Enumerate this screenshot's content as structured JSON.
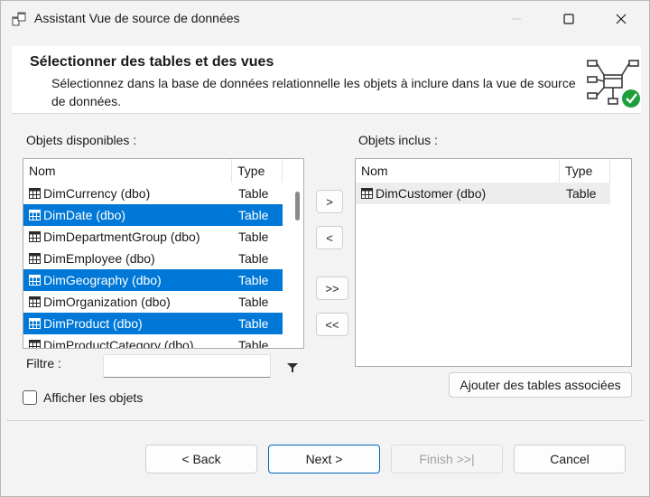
{
  "window": {
    "title": "Assistant Vue de source de données",
    "icon": "data-source-view-icon"
  },
  "header": {
    "title": "Sélectionner des tables et des vues",
    "description": "Sélectionnez dans la base de données relationnelle les objets à inclure dans la vue de source de données.",
    "icon": "network-check-icon"
  },
  "available": {
    "label": "Objets disponibles :",
    "columns": {
      "name": "Nom",
      "type": "Type"
    },
    "rows": [
      {
        "name": "DimCurrency (dbo)",
        "type": "Table",
        "selected": false
      },
      {
        "name": "DimDate (dbo)",
        "type": "Table",
        "selected": true
      },
      {
        "name": "DimDepartmentGroup (dbo)",
        "type": "Table",
        "selected": false
      },
      {
        "name": "DimEmployee (dbo)",
        "type": "Table",
        "selected": false
      },
      {
        "name": "DimGeography (dbo)",
        "type": "Table",
        "selected": true
      },
      {
        "name": "DimOrganization (dbo)",
        "type": "Table",
        "selected": false
      },
      {
        "name": "DimProduct (dbo)",
        "type": "Table",
        "selected": true
      },
      {
        "name": "DimProductCategory (dbo)",
        "type": "Table",
        "selected": false
      }
    ]
  },
  "included": {
    "label": "Objets inclus :",
    "columns": {
      "name": "Nom",
      "type": "Type"
    },
    "rows": [
      {
        "name": "DimCustomer (dbo)",
        "type": "Table"
      }
    ]
  },
  "move_buttons": {
    "add": ">",
    "remove": "<",
    "add_all": ">>",
    "remove_all": "<<"
  },
  "filter": {
    "label": "Filtre :",
    "value": ""
  },
  "show_objects": {
    "label": "Afficher les objets",
    "checked": false
  },
  "add_related_label": "Ajouter des tables associées",
  "footer": {
    "back": "< Back",
    "next": "Next >",
    "finish": "Finish >>|",
    "cancel": "Cancel"
  }
}
